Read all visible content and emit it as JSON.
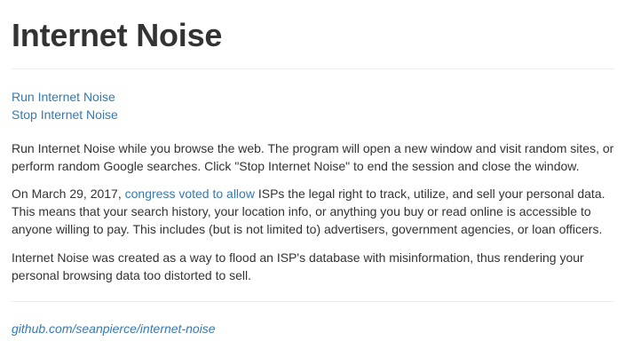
{
  "header": {
    "title": "Internet Noise"
  },
  "actions": {
    "run_label": "Run Internet Noise",
    "stop_label": "Stop Internet Noise"
  },
  "content": {
    "intro": "Run Internet Noise while you browse the web. The program will open a new window and visit random sites, or perform random Google searches. Click \"Stop Internet Noise\" to end the session and close the window.",
    "law_prefix": "On March 29, 2017, ",
    "law_link": "congress voted to allow",
    "law_suffix": " ISPs the legal right to track, utilize, and sell your personal data. This means that your search history, your location info, or anything you buy or read online is accessible to anyone willing to pay. This includes (but is not limited to) advertisers, government agencies, or loan officers.",
    "purpose": "Internet Noise was created as a way to flood an ISP's database with misinformation, thus rendering your personal browsing data too distorted to sell."
  },
  "footer": {
    "repo_link": "github.com/seanpierce/internet-noise"
  },
  "colors": {
    "link": "#337ab7",
    "text": "#333333",
    "rule": "#eeeeee"
  }
}
